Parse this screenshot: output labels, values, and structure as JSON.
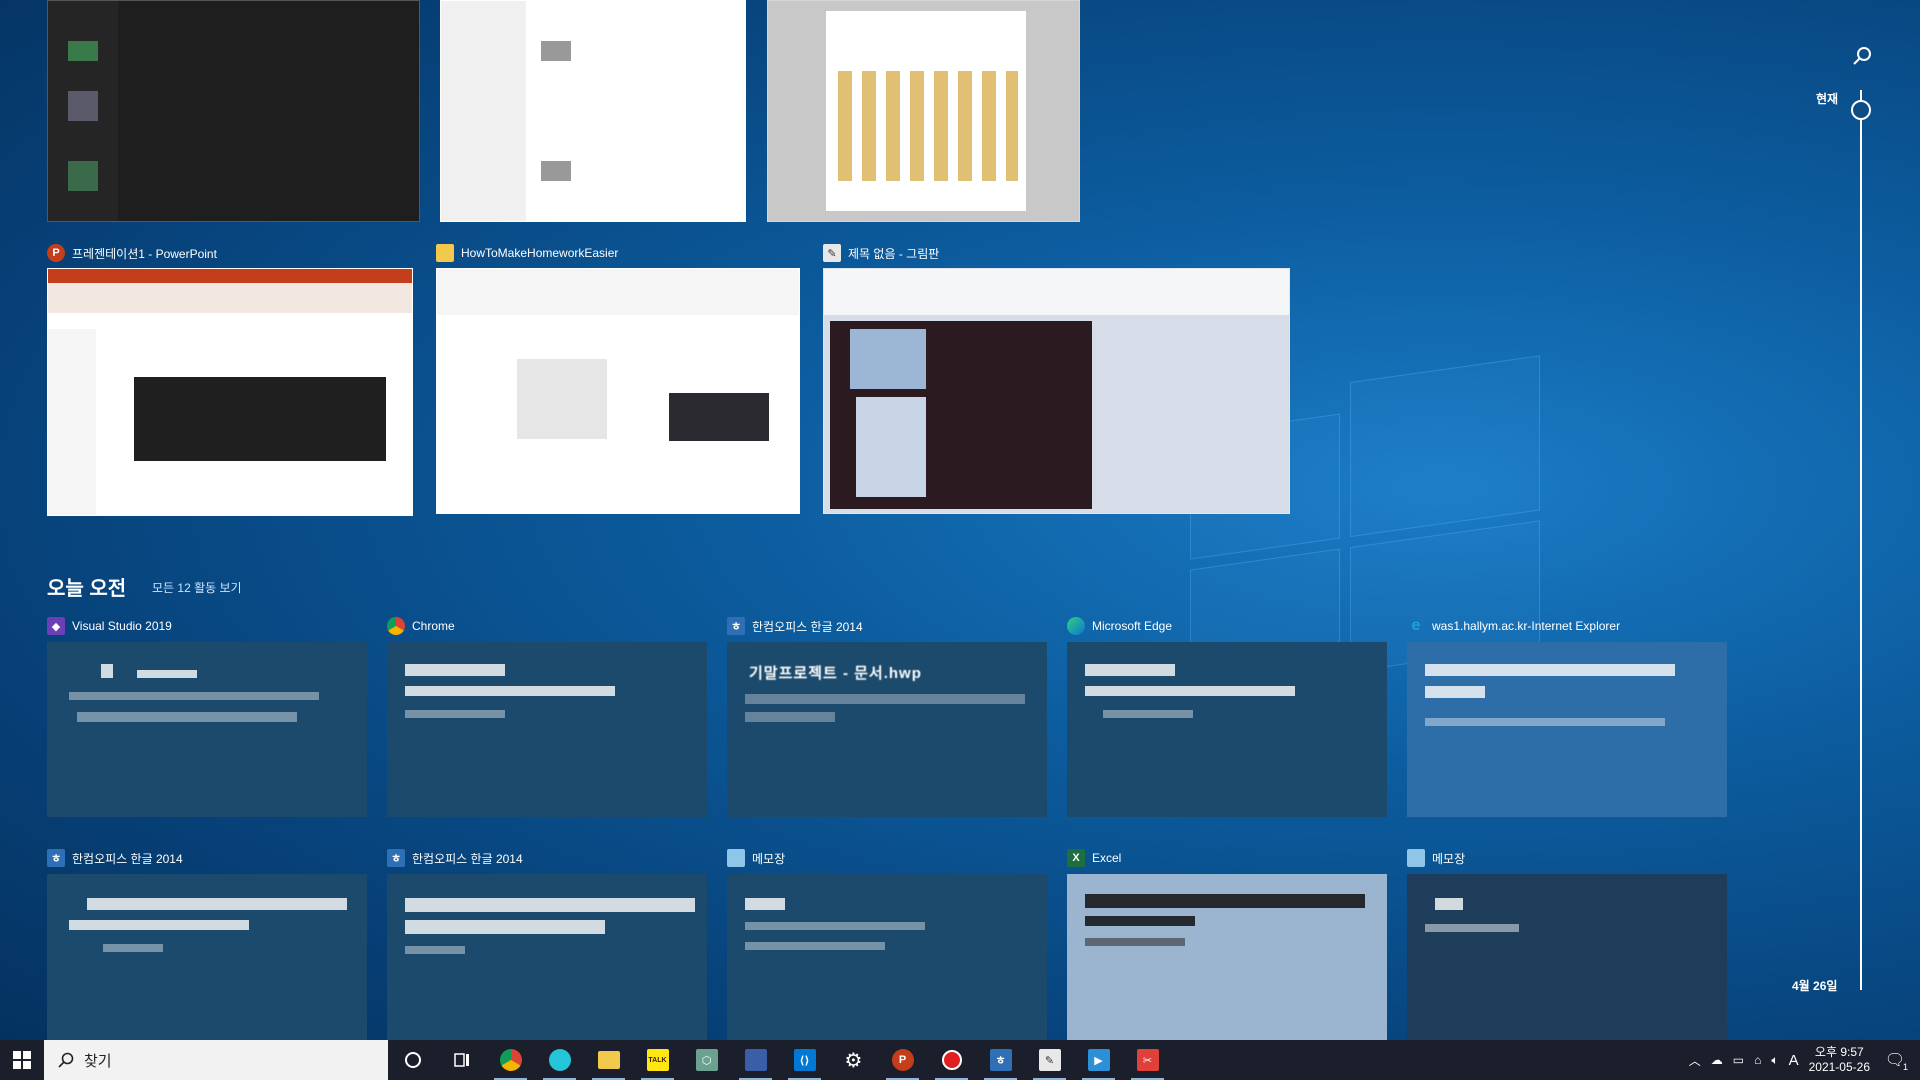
{
  "thumbnails": [
    {
      "label": "프레젠테이션1 - PowerPoint",
      "icon": "powerpoint-icon"
    },
    {
      "label": "HowToMakeHomeworkEasier",
      "icon": "folder-icon"
    },
    {
      "label": "제목 없음 - 그림판",
      "icon": "paint-icon"
    }
  ],
  "timeline": {
    "section_title": "오늘 오전",
    "section_link": "모든 12 활동 보기",
    "now_label": "현재",
    "date_label": "4월 26일"
  },
  "cards_row1": [
    {
      "app": "Visual Studio 2019",
      "icon": "visual-studio-icon",
      "title": "",
      "sub": ""
    },
    {
      "app": "Chrome",
      "icon": "chrome-icon",
      "title": "",
      "sub": ""
    },
    {
      "app": "한컴오피스 한글 2014",
      "icon": "hwp-icon",
      "title": "기말프로젝트 - 문서.hwp",
      "sub": ""
    },
    {
      "app": "Microsoft Edge",
      "icon": "edge-icon",
      "title": "",
      "sub": ""
    },
    {
      "app": "was1.hallym.ac.kr-Internet Explorer",
      "icon": "ie-icon",
      "title": "",
      "sub": ""
    }
  ],
  "cards_row2": [
    {
      "app": "한컴오피스 한글 2014",
      "icon": "hwp-icon",
      "title": "",
      "sub": ""
    },
    {
      "app": "한컴오피스 한글 2014",
      "icon": "hwp-icon",
      "title": "",
      "sub": ""
    },
    {
      "app": "메모장",
      "icon": "notepad-icon",
      "title": "",
      "sub": ""
    },
    {
      "app": "Excel",
      "icon": "excel-icon",
      "title": "",
      "sub": ""
    },
    {
      "app": "메모장",
      "icon": "notepad-icon",
      "title": "",
      "sub": ""
    }
  ],
  "taskbar": {
    "search_placeholder": "찾기",
    "time": "오후 9:57",
    "date": "2021-05-26",
    "ime": "A",
    "notification_count": "1"
  },
  "colors": {
    "card_bg": "#1c4a6c",
    "taskbar_bg": "#1a1f2b"
  }
}
